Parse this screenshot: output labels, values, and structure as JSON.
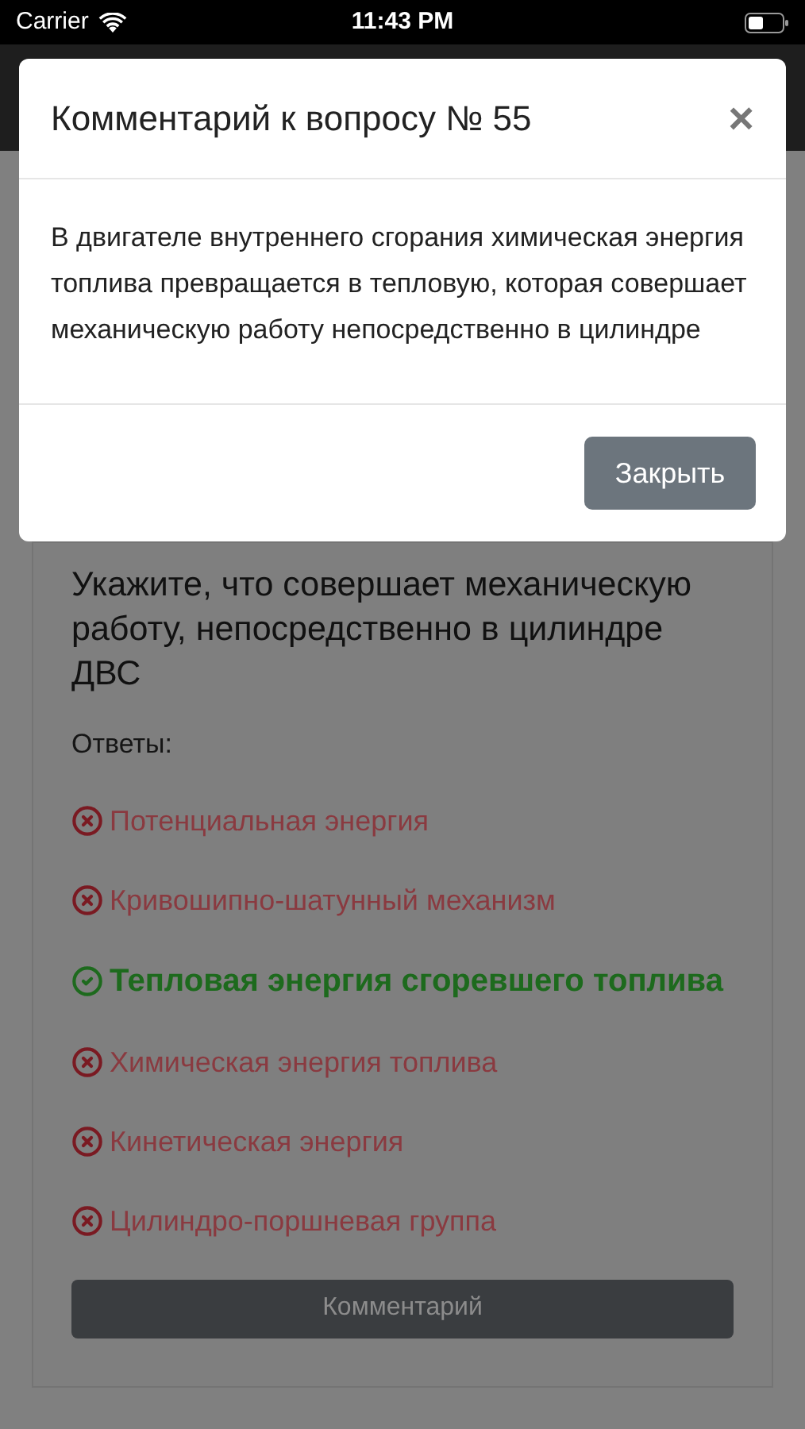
{
  "status_bar": {
    "carrier": "Carrier",
    "time": "11:43 PM"
  },
  "question": {
    "text": "Укажите, что совершает механическую работу, непосредственно в цилиндре ДВС",
    "answers_label": "Ответы:",
    "answers": [
      {
        "text": "Потенциальная энергия",
        "correct": false
      },
      {
        "text": "Кривошипно-шатунный механизм",
        "correct": false
      },
      {
        "text": "Тепловая энергия сгоревшего топлива",
        "correct": true
      },
      {
        "text": "Химическая энергия топлива",
        "correct": false
      },
      {
        "text": "Кинетическая энергия",
        "correct": false
      },
      {
        "text": "Цилиндро-поршневая группа",
        "correct": false
      }
    ],
    "comment_button": "Комментарий"
  },
  "modal": {
    "title": "Комментарий к вопросу № 55",
    "close": "×",
    "body": "В двигателе внутреннего сгорания химическая энергия топлива превращается в тепловую, которая совершает механическую работу непосредственно в цилиндре",
    "button": "Закрыть"
  }
}
